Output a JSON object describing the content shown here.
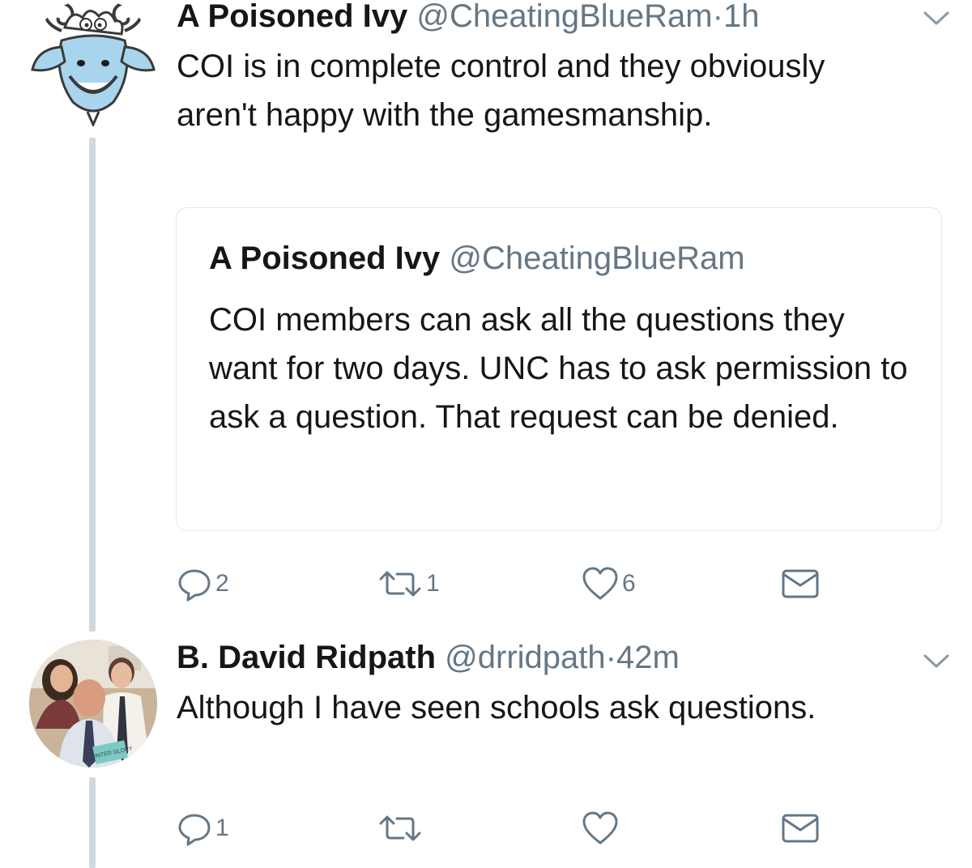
{
  "tweets": [
    {
      "name": "A Poisoned Ivy",
      "handle": "@CheatingBlueRam",
      "separator": "·",
      "time": "1h",
      "avatar_icon": "cartoon-ram-icon",
      "text": "COI is in complete control and they obviously aren't happy with the gamesmanship.",
      "quoted": {
        "name": "A Poisoned Ivy",
        "handle": "@CheatingBlueRam",
        "text": "COI members can ask all the questions they want for two days. UNC has to ask permission to ask a question. That request can be denied."
      },
      "actions": {
        "replies": "2",
        "retweets": "1",
        "likes": "6"
      }
    },
    {
      "name": "B. David Ridpath",
      "handle": "@drridpath",
      "separator": "·",
      "time": "42m",
      "avatar_icon": "family-photo-avatar",
      "avatar_sign": "TAINTED GLORY",
      "text": "Although I have seen schools ask questions.",
      "actions": {
        "replies": "1",
        "retweets": "",
        "likes": ""
      }
    }
  ],
  "colors": {
    "text": "#14171a",
    "secondary": "#657786",
    "thread_line": "#cfd9de",
    "border": "#e1e8ed",
    "avatar_blue": "#a9d4ee"
  }
}
